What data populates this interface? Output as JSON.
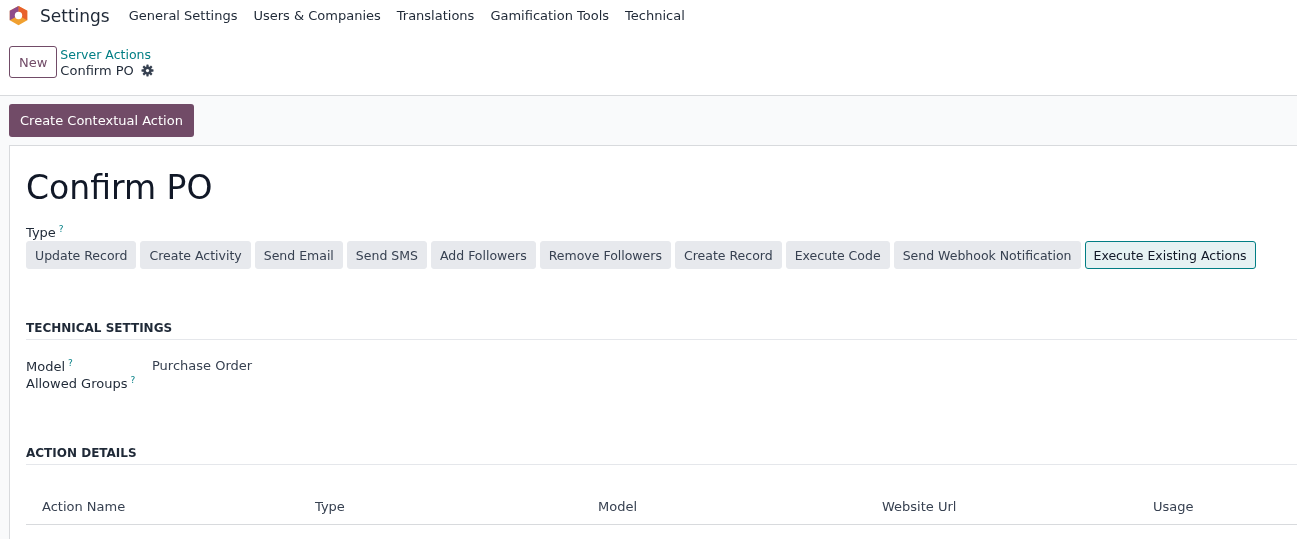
{
  "navbar": {
    "app_name": "Settings",
    "menu": [
      "General Settings",
      "Users & Companies",
      "Translations",
      "Gamification Tools",
      "Technical"
    ]
  },
  "control_panel": {
    "new_button": "New",
    "breadcrumb": "Server Actions",
    "record": "Confirm PO"
  },
  "action_button": "Create Contextual Action",
  "form": {
    "title": "Confirm PO",
    "type_field": {
      "label": "Type",
      "help": "?",
      "options": [
        {
          "label": "Update Record",
          "selected": false
        },
        {
          "label": "Create Activity",
          "selected": false
        },
        {
          "label": "Send Email",
          "selected": false
        },
        {
          "label": "Send SMS",
          "selected": false
        },
        {
          "label": "Add Followers",
          "selected": false
        },
        {
          "label": "Remove Followers",
          "selected": false
        },
        {
          "label": "Create Record",
          "selected": false
        },
        {
          "label": "Execute Code",
          "selected": false
        },
        {
          "label": "Send Webhook Notification",
          "selected": false
        },
        {
          "label": "Execute Existing Actions",
          "selected": true
        }
      ]
    },
    "sections": [
      {
        "title": "TECHNICAL SETTINGS",
        "fields": [
          {
            "label": "Model",
            "help": "?",
            "value": "Purchase Order"
          },
          {
            "label": "Allowed Groups",
            "help": "?"
          }
        ]
      },
      {
        "title": "ACTION DETAILS",
        "table": {
          "columns": [
            "Action Name",
            "Type",
            "Model",
            "Website Url",
            "Usage"
          ]
        }
      }
    ]
  }
}
